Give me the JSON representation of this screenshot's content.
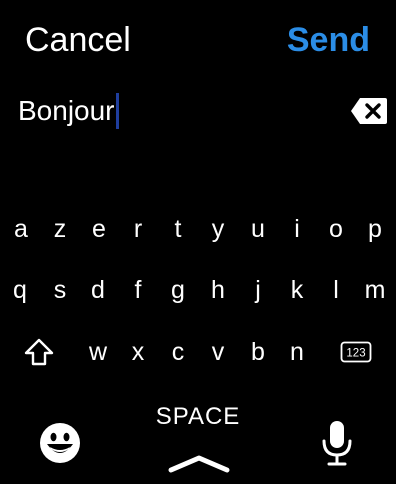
{
  "header": {
    "cancel_label": "Cancel",
    "send_label": "Send",
    "send_color": "#2b8de6"
  },
  "input": {
    "value": "Bonjour"
  },
  "keyboard": {
    "row1": [
      "a",
      "z",
      "e",
      "r",
      "t",
      "y",
      "u",
      "i",
      "o",
      "p"
    ],
    "row2": [
      "q",
      "s",
      "d",
      "f",
      "g",
      "h",
      "j",
      "k",
      "l",
      "m"
    ],
    "row3": [
      "w",
      "x",
      "c",
      "v",
      "b",
      "n"
    ],
    "numbers_key_label": "123",
    "space_label": "SPACE",
    "icons": {
      "backspace": "backspace-icon",
      "shift": "shift-icon",
      "emoji": "emoji-icon",
      "chevron": "chevron-up-icon",
      "microphone": "microphone-icon"
    }
  }
}
